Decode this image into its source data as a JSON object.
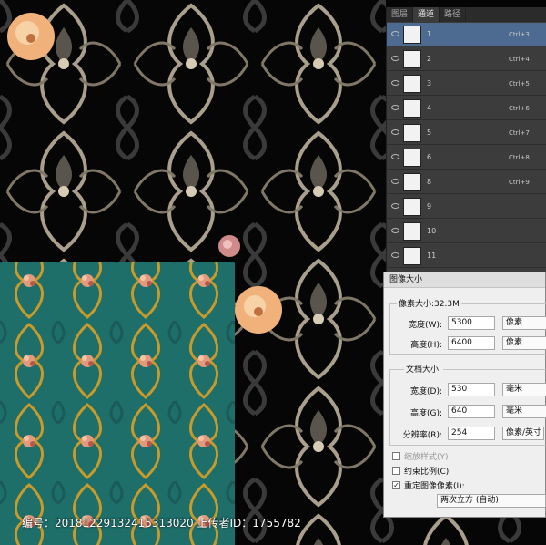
{
  "channels_panel": {
    "tabs": [
      "图层",
      "通道",
      "路径"
    ],
    "active_tab": 1,
    "channels": [
      {
        "name": "1",
        "shortcut": "Ctrl+3"
      },
      {
        "name": "2",
        "shortcut": "Ctrl+4"
      },
      {
        "name": "3",
        "shortcut": "Ctrl+5"
      },
      {
        "name": "4",
        "shortcut": "Ctrl+6"
      },
      {
        "name": "5",
        "shortcut": "Ctrl+7"
      },
      {
        "name": "6",
        "shortcut": "Ctrl+8"
      },
      {
        "name": "8",
        "shortcut": "Ctrl+9"
      },
      {
        "name": "9",
        "shortcut": ""
      },
      {
        "name": "10",
        "shortcut": ""
      },
      {
        "name": "11",
        "shortcut": ""
      }
    ]
  },
  "image_size_dialog": {
    "title": "图像大小",
    "pixel_dimensions": {
      "label": "像素大小:32.3M",
      "width": {
        "label": "宽度(W):",
        "value": "5300",
        "unit": "像素"
      },
      "height": {
        "label": "高度(H):",
        "value": "6400",
        "unit": "像素"
      }
    },
    "document_size": {
      "label": "文档大小:",
      "width": {
        "label": "宽度(D):",
        "value": "530",
        "unit": "毫米"
      },
      "height": {
        "label": "高度(G):",
        "value": "640",
        "unit": "毫米"
      },
      "resolution": {
        "label": "分辨率(R):",
        "value": "254",
        "unit": "像素/英寸"
      }
    },
    "scale_styles": {
      "label": "缩放样式(Y)",
      "checked": false
    },
    "constrain_proportions": {
      "label": "约束比例(C)",
      "checked": false
    },
    "resample": {
      "label": "重定图像像素(I):",
      "checked": true,
      "method": "两次立方 (自动)"
    }
  },
  "footer": {
    "text": "编号：20181229132415313020 上传者ID：1755782"
  },
  "colors": {
    "background": "#050505",
    "teal_pattern": "#1e6e6a",
    "gold_scroll": "#c79a2a",
    "silver_scroll": "#b8b0a0",
    "selection_blue": "#4d6b91"
  }
}
